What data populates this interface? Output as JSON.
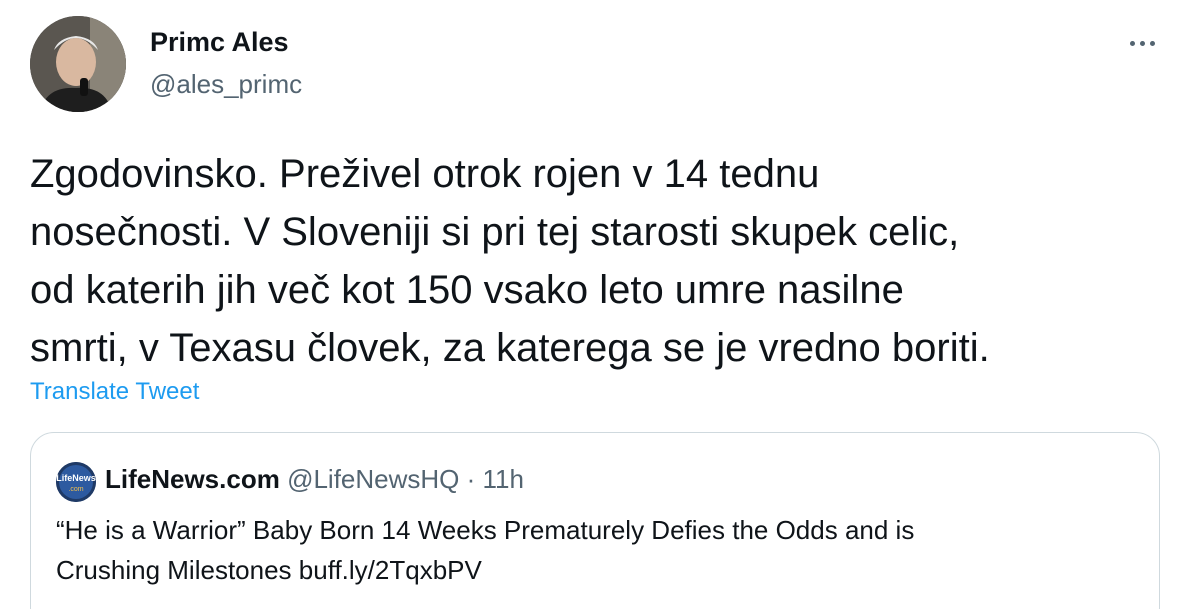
{
  "author": {
    "name": "Primc Ales",
    "handle": "@ales_primc",
    "avatar_icon": "profile-photo"
  },
  "more_icon": "more-horizontal-icon",
  "tweet": {
    "lines": [
      "Zgodovinsko. Preživel otrok rojen v 14 tednu",
      "nosečnosti. V Sloveniji si pri tej starosti skupek celic,",
      "od katerih jih več kot 150 vsako leto umre nasilne",
      "smrti, v Texasu človek, za katerega se je vredno boriti."
    ],
    "translate_label": "Translate Tweet"
  },
  "quote": {
    "avatar_text": "LifeNews",
    "avatar_subtext": ".com",
    "name": "LifeNews.com",
    "handle": "@LifeNewsHQ",
    "separator": "·",
    "time": "11h",
    "lines": [
      "“He is a Warrior” Baby Born 14 Weeks Prematurely Defies the Odds and is",
      "Crushing Milestones buff.ly/2TqxbPV"
    ]
  },
  "colors": {
    "primary_text": "#0f1419",
    "secondary_text": "#536471",
    "link": "#1d9bf0",
    "border": "#cfd9de"
  }
}
